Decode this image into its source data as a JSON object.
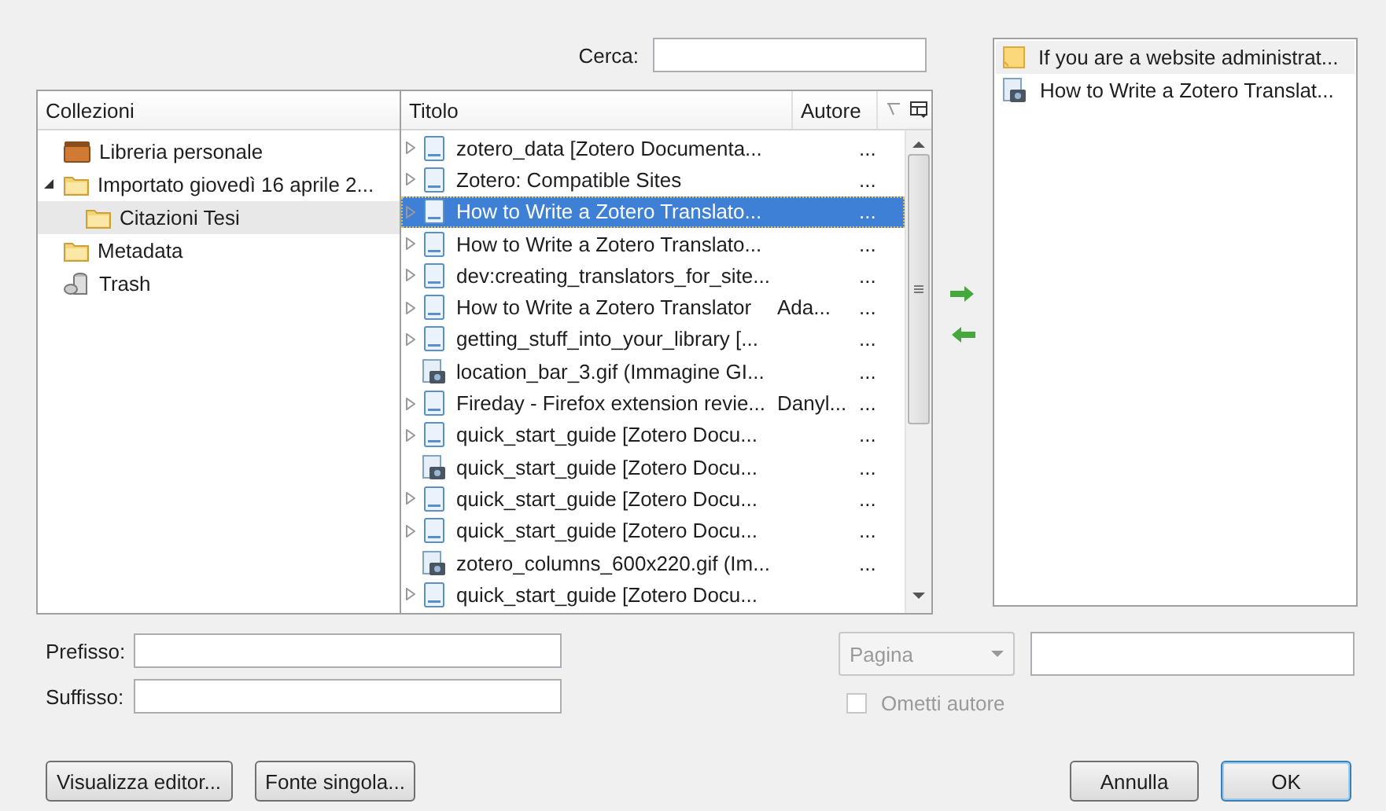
{
  "search": {
    "label": "Cerca:"
  },
  "collections": {
    "header": "Collezioni",
    "items": [
      {
        "label": "Libreria personale",
        "kind": "library",
        "selected": false
      },
      {
        "label": "Importato giovedì 16 aprile 2...",
        "kind": "folder",
        "selected": false,
        "expanded": true,
        "children": [
          {
            "label": "Citazioni Tesi",
            "kind": "folder",
            "selected": true
          }
        ]
      },
      {
        "label": "Metadata",
        "kind": "folder",
        "selected": false
      },
      {
        "label": "Trash",
        "kind": "trash",
        "selected": false
      }
    ]
  },
  "items": {
    "columns": [
      "Titolo",
      "Autore"
    ],
    "rows": [
      {
        "title": "zotero_data [Zotero Documenta...",
        "author": "",
        "column_3": "...",
        "kind": "document",
        "selected": false
      },
      {
        "title": "Zotero: Compatible Sites",
        "author": "",
        "column_3": "...",
        "kind": "document",
        "selected": false
      },
      {
        "title": "How to Write a Zotero Translato...",
        "author": "",
        "column_3": "...",
        "kind": "document",
        "selected": true
      },
      {
        "title": "How to Write a Zotero Translato...",
        "author": "",
        "column_3": "...",
        "kind": "document",
        "selected": false
      },
      {
        "title": "dev:creating_translators_for_site...",
        "author": "",
        "column_3": "...",
        "kind": "document",
        "selected": false
      },
      {
        "title": "How to Write a Zotero Translator",
        "author": "Ada...",
        "column_3": "...",
        "kind": "document",
        "selected": false
      },
      {
        "title": "getting_stuff_into_your_library [...",
        "author": "",
        "column_3": "...",
        "kind": "document",
        "selected": false
      },
      {
        "title": "location_bar_3.gif (Immagine GI...",
        "author": "",
        "column_3": "...",
        "kind": "image",
        "selected": false
      },
      {
        "title": "Fireday - Firefox extension revie...",
        "author": "Danyl...",
        "column_3": "...",
        "kind": "document",
        "selected": false
      },
      {
        "title": "quick_start_guide [Zotero Docu...",
        "author": "",
        "column_3": "...",
        "kind": "document",
        "selected": false
      },
      {
        "title": "quick_start_guide [Zotero Docu...",
        "author": "",
        "column_3": "...",
        "kind": "image",
        "selected": false
      },
      {
        "title": "quick_start_guide [Zotero Docu...",
        "author": "",
        "column_3": "...",
        "kind": "document",
        "selected": false
      },
      {
        "title": "quick_start_guide [Zotero Docu...",
        "author": "",
        "column_3": "...",
        "kind": "document",
        "selected": false
      },
      {
        "title": "zotero_columns_600x220.gif (Im...",
        "author": "",
        "column_3": "...",
        "kind": "image",
        "selected": false
      },
      {
        "title": "quick_start_guide [Zotero Docu...",
        "author": "",
        "column_3": "",
        "kind": "document",
        "selected": false
      }
    ]
  },
  "citation_list": [
    {
      "title": "If you are a website administrat...",
      "kind": "note",
      "selected": true
    },
    {
      "title": "How to Write a Zotero Translat...",
      "kind": "image",
      "selected": false
    }
  ],
  "prefix": {
    "label": "Prefisso:"
  },
  "suffix": {
    "label": "Suffisso:"
  },
  "locator": {
    "value": "Pagina",
    "disabled": true
  },
  "omit_author": {
    "label": "Ometti autore",
    "checked": false,
    "disabled": true
  },
  "buttons": [
    {
      "label": "Visualizza editor...",
      "default": false
    },
    {
      "label": "Fonte singola...",
      "default": false
    },
    {
      "label": "Annulla",
      "default": false
    },
    {
      "label": "OK",
      "default": true
    }
  ]
}
